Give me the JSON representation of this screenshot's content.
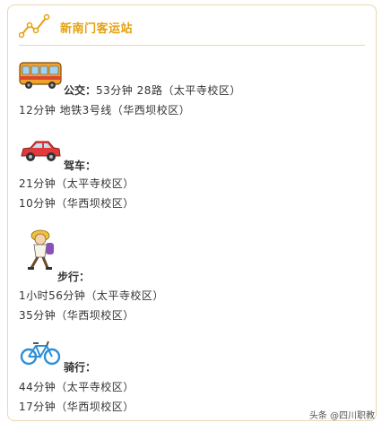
{
  "header": {
    "title": "新南门客运站",
    "accent_color": "#e5a10f",
    "icon": "line-graph-icon"
  },
  "sections": {
    "bus": {
      "icon": "bus-icon",
      "label": "公交：",
      "first_line": "53分钟 28路（太平寺校区）",
      "second_line": "12分钟 地铁3号线（华西坝校区）"
    },
    "car": {
      "icon": "car-icon",
      "label": "驾车：",
      "lines": [
        "21分钟（太平寺校区）",
        "10分钟（华西坝校区）"
      ]
    },
    "walk": {
      "icon": "walking-person-icon",
      "label": "步行：",
      "lines": [
        "1小时56分钟（太平寺校区）",
        "35分钟（华西坝校区）"
      ]
    },
    "bike": {
      "icon": "bicycle-icon",
      "label": "骑行：",
      "lines": [
        "44分钟（太平寺校区）",
        "17分钟（华西坝校区）"
      ]
    }
  },
  "watermark": "头条 @四川职教"
}
